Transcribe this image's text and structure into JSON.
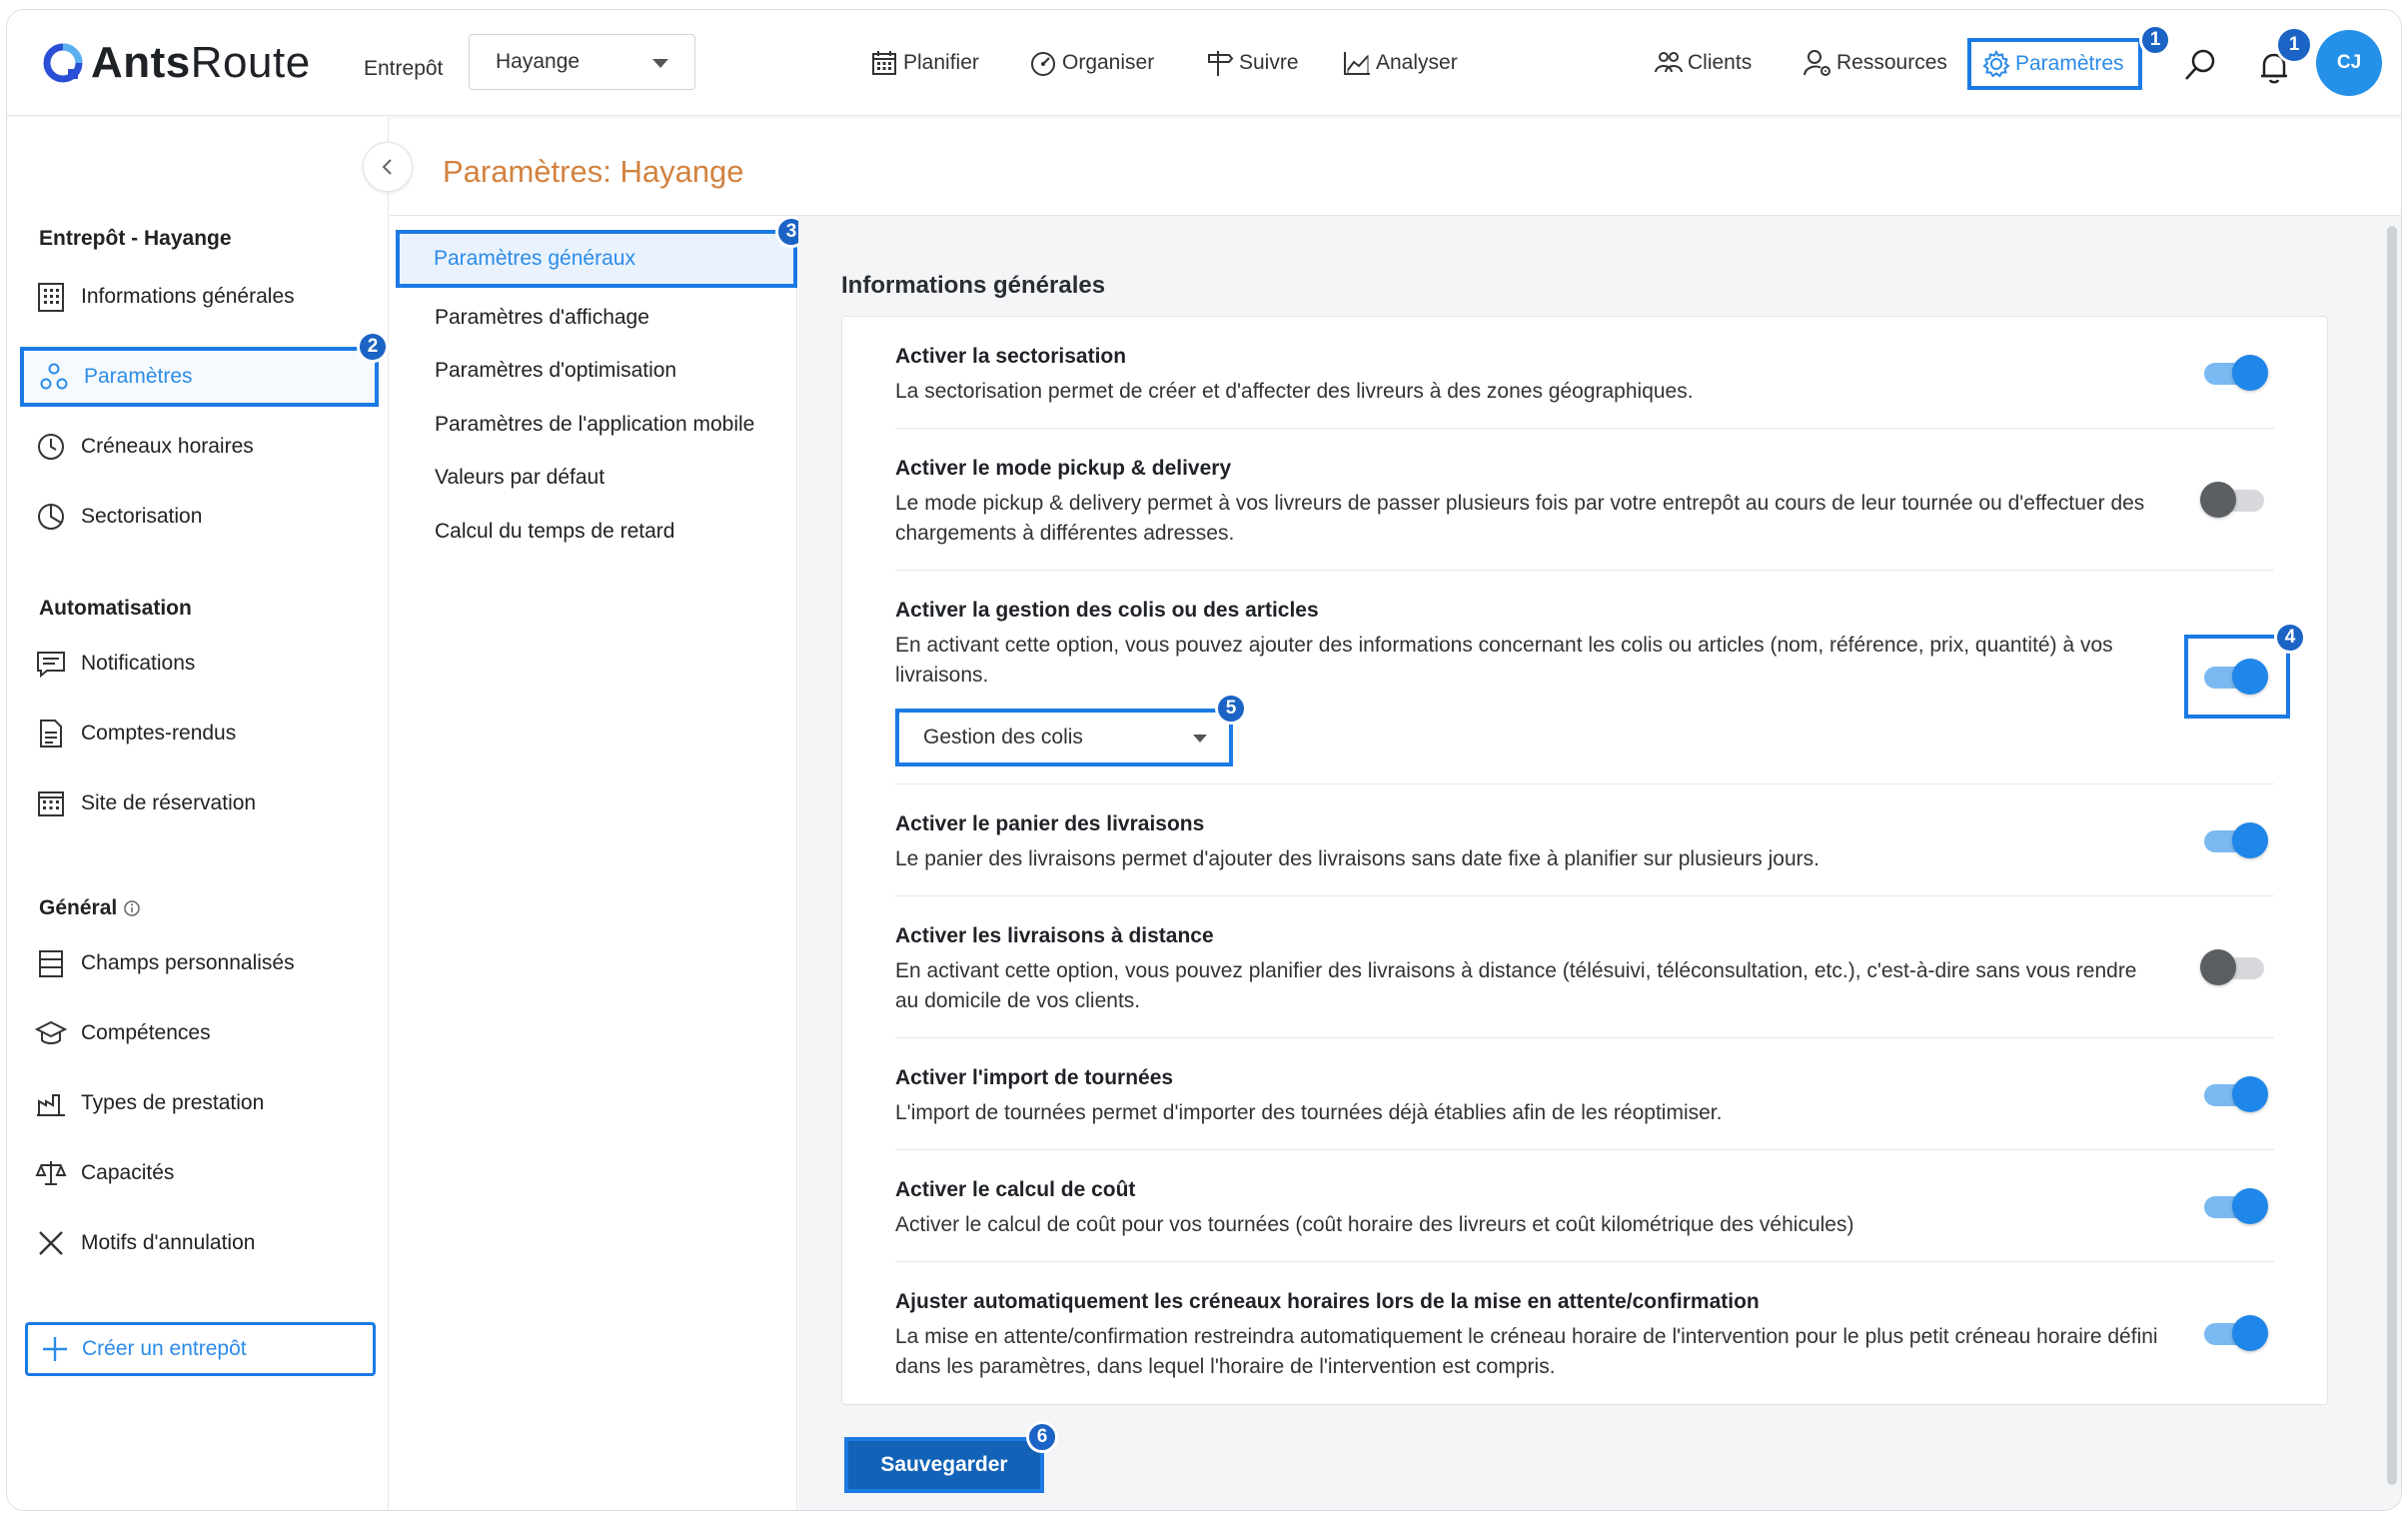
{
  "app": {
    "logo_bold": "Ants",
    "logo_rest": "Route"
  },
  "header": {
    "warehouse_label": "Entrepôt",
    "warehouse_value": "Hayange",
    "nav": [
      {
        "label": "Planifier",
        "icon": "calendar-icon"
      },
      {
        "label": "Organiser",
        "icon": "gauge-icon"
      },
      {
        "label": "Suivre",
        "icon": "signpost-icon"
      },
      {
        "label": "Analyser",
        "icon": "chart-icon"
      },
      {
        "label": "Clients",
        "icon": "users-icon"
      },
      {
        "label": "Ressources",
        "icon": "user-gear-icon"
      },
      {
        "label": "Paramètres",
        "icon": "gear-icon"
      }
    ],
    "notification_count": "1",
    "avatar_initials": "CJ"
  },
  "page_title": "Paramètres: Hayange",
  "sidebar": {
    "section_warehouse": "Entrepôt - Hayange",
    "items_warehouse": [
      {
        "label": "Informations générales",
        "icon": "building-icon"
      },
      {
        "label": "Paramètres",
        "icon": "settings-nodes-icon"
      },
      {
        "label": "Créneaux horaires",
        "icon": "clock-icon"
      },
      {
        "label": "Sectorisation",
        "icon": "pie-icon"
      }
    ],
    "section_automation": "Automatisation",
    "items_automation": [
      {
        "label": "Notifications",
        "icon": "message-icon"
      },
      {
        "label": "Comptes-rendus",
        "icon": "document-icon"
      },
      {
        "label": "Site de réservation",
        "icon": "calendar-grid-icon"
      }
    ],
    "section_general": "Général",
    "items_general": [
      {
        "label": "Champs personnalisés",
        "icon": "fields-icon"
      },
      {
        "label": "Compétences",
        "icon": "graduation-icon"
      },
      {
        "label": "Types de prestation",
        "icon": "factory-icon"
      },
      {
        "label": "Capacités",
        "icon": "scale-icon"
      },
      {
        "label": "Motifs d'annulation",
        "icon": "x-icon"
      }
    ],
    "create_label": "Créer un entrepôt"
  },
  "subnav": [
    "Paramètres généraux",
    "Paramètres d'affichage",
    "Paramètres d'optimisation",
    "Paramètres de l'application mobile",
    "Valeurs par défaut",
    "Calcul du temps de retard"
  ],
  "main": {
    "section_title": "Informations générales",
    "settings": [
      {
        "title": "Activer la sectorisation",
        "desc": "La sectorisation permet de créer et d'affecter des livreurs à des zones géographiques.",
        "enabled": true
      },
      {
        "title": "Activer le mode pickup & delivery",
        "desc": "Le mode pickup & delivery permet à vos livreurs de passer plusieurs fois par votre entrepôt au cours de leur tournée ou d'effectuer des chargements à différentes adresses.",
        "enabled": false
      },
      {
        "title": "Activer la gestion des colis ou des articles",
        "desc": "En activant cette option, vous pouvez ajouter des informations concernant les colis ou articles (nom, référence, prix, quantité) à vos livraisons.",
        "enabled": true
      },
      {
        "title": "Activer le panier des livraisons",
        "desc": "Le panier des livraisons permet d'ajouter des livraisons sans date fixe à planifier sur plusieurs jours.",
        "enabled": true
      },
      {
        "title": "Activer les livraisons à distance",
        "desc": "En activant cette option, vous pouvez planifier des livraisons à distance (télésuivi, téléconsultation, etc.), c'est-à-dire sans vous rendre au domicile de vos clients.",
        "enabled": false
      },
      {
        "title": "Activer l'import de tournées",
        "desc": "L'import de tournées permet d'importer des tournées déjà établies afin de les réoptimiser.",
        "enabled": true
      },
      {
        "title": "Activer le calcul de coût",
        "desc": "Activer le calcul de coût pour vos tournées (coût horaire des livreurs et coût kilométrique des véhicules)",
        "enabled": true
      },
      {
        "title": "Ajuster automatiquement les créneaux horaires lors de la mise en attente/confirmation",
        "desc": "La mise en attente/confirmation restreindra automatiquement le créneau horaire de l'intervention pour le plus petit créneau horaire défini dans les paramètres, dans lequel l'horaire de l'intervention est compris.",
        "enabled": true
      }
    ],
    "parcel_mode_value": "Gestion des colis",
    "save_label": "Sauvegarder"
  },
  "annotations": [
    "1",
    "2",
    "3",
    "4",
    "5",
    "6"
  ],
  "colors": {
    "accent": "#1b7ae4",
    "title": "#d2823f",
    "save": "#1262b7",
    "badge": "#1b63c4"
  }
}
